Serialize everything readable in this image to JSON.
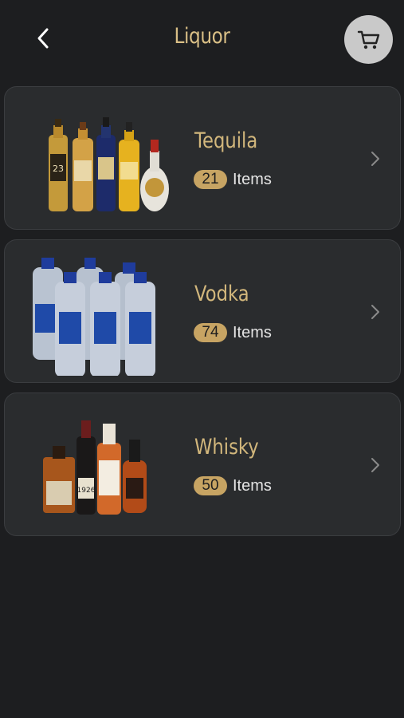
{
  "header": {
    "title": "Liquor",
    "back_icon": "chevron-left-icon",
    "cart_icon": "cart-icon"
  },
  "categories": [
    {
      "name": "Tequila",
      "count": "21",
      "count_label": "Items",
      "image": "tequila-bottles"
    },
    {
      "name": "Vodka",
      "count": "74",
      "count_label": "Items",
      "image": "water-bottles"
    },
    {
      "name": "Whisky",
      "count": "50",
      "count_label": "Items",
      "image": "whisky-bottles"
    }
  ],
  "colors": {
    "background": "#1d1e20",
    "card": "#2a2c2e",
    "accent": "#d2b77c",
    "badge": "#c7a463"
  }
}
